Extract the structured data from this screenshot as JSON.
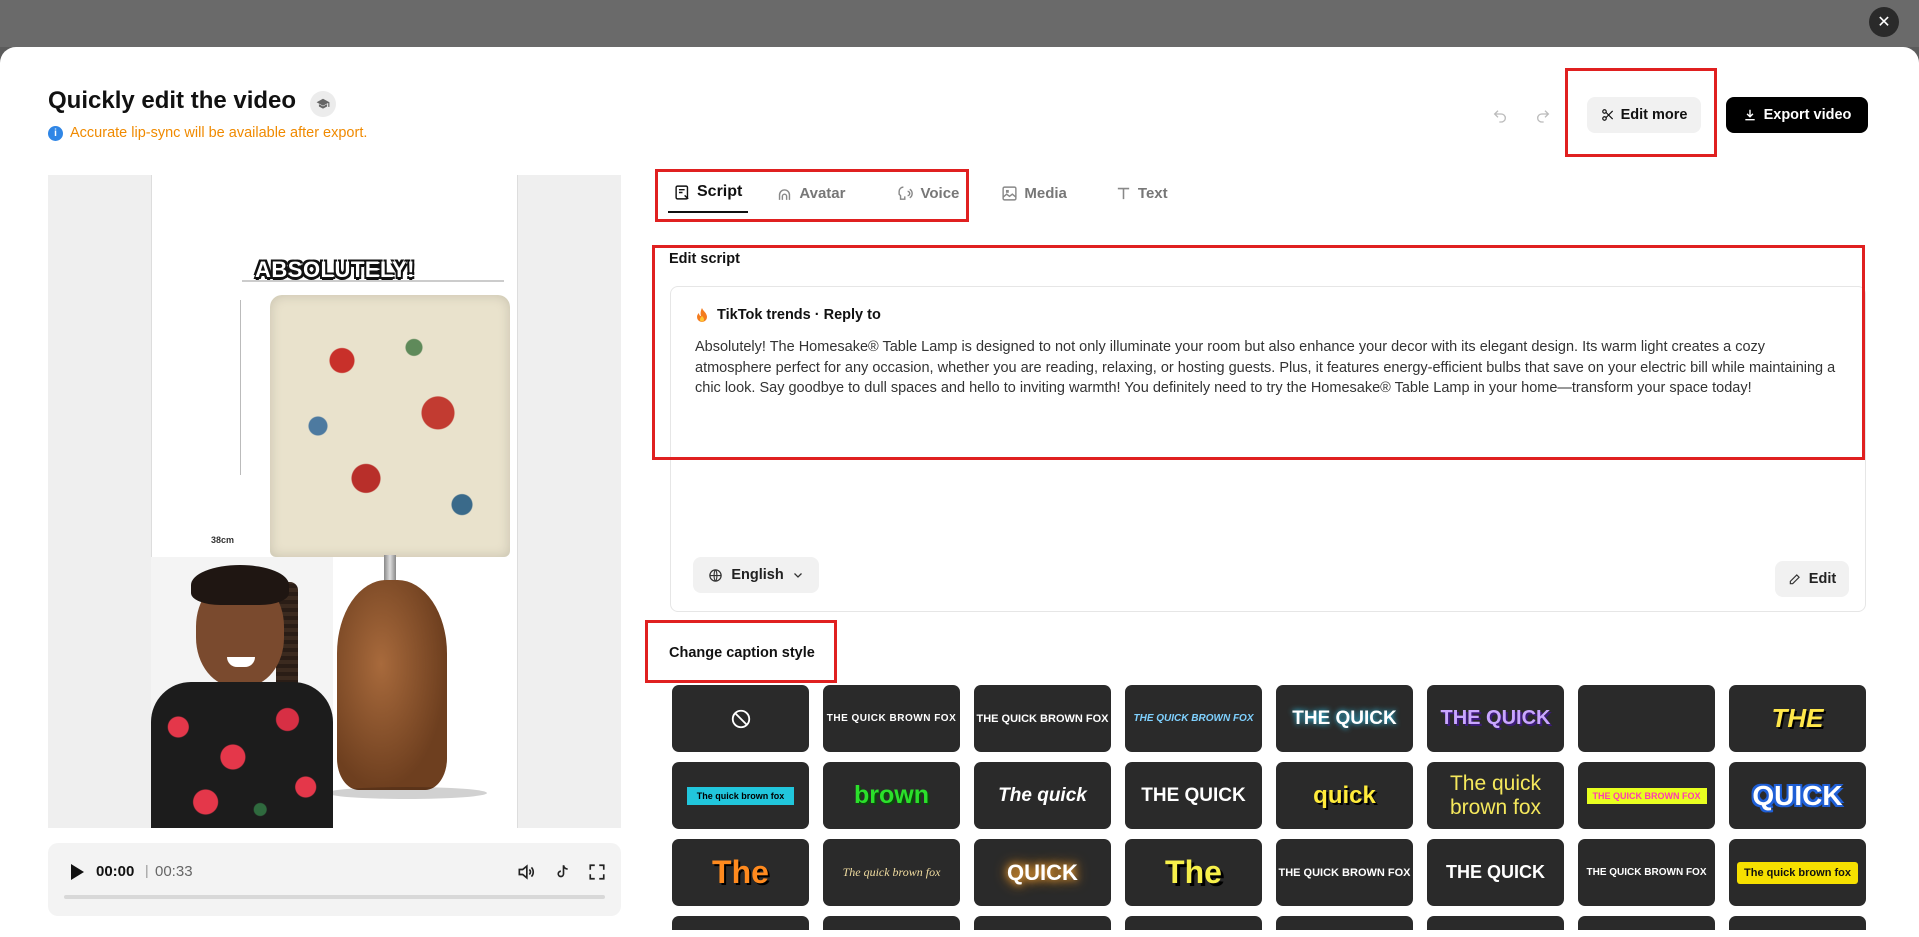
{
  "modal": {
    "title": "Quickly edit the video",
    "notice": "Accurate lip-sync will be available after export.",
    "edit_more_label": "Edit more",
    "export_label": "Export video"
  },
  "preview": {
    "caption_word": "ABSOLUTELY!",
    "dimension_label": "38cm",
    "time_current": "00:00",
    "time_total": "00:33",
    "progress_fraction": 0
  },
  "tabs": [
    {
      "label": "Script",
      "icon": "script-icon",
      "active": true
    },
    {
      "label": "Avatar",
      "icon": "avatar-icon",
      "active": false
    },
    {
      "label": "Voice",
      "icon": "voice-icon",
      "active": false
    },
    {
      "label": "Media",
      "icon": "media-icon",
      "active": false
    },
    {
      "label": "Text",
      "icon": "text-icon",
      "active": false
    }
  ],
  "script": {
    "section_title": "Edit script",
    "trend_label": "TikTok trends · Reply to",
    "text": "Absolutely! The Homesake® Table Lamp is designed to not only illuminate your room but also enhance your decor with its elegant design. Its warm light creates a cozy atmosphere perfect for any occasion, whether you are reading, relaxing, or hosting guests. Plus, it features energy-efficient bulbs that save on your electric bill while maintaining a chic look. Say goodbye to dull spaces and hello to inviting warmth! You definitely need to try the Homesake® Table Lamp in your home—transform your space today!",
    "language": "English",
    "edit_label": "Edit"
  },
  "caption_styles": {
    "section_title": "Change caption style",
    "items": [
      {
        "label": "",
        "kind": "none"
      },
      {
        "label": "THE QUICK BROWN FOX",
        "kind": "s1"
      },
      {
        "label": "THE QUICK BROWN FOX",
        "kind": "s2"
      },
      {
        "label": "THE QUICK BROWN FOX",
        "kind": "s3"
      },
      {
        "label": "THE QUICK",
        "kind": "s4"
      },
      {
        "label": "THE QUICK",
        "kind": "s5"
      },
      {
        "label": "",
        "kind": "blank"
      },
      {
        "label": "THE",
        "kind": "s7"
      },
      {
        "label": "The quick brown fox",
        "kind": "s8"
      },
      {
        "label": "brown",
        "kind": "s9"
      },
      {
        "label": "The quick",
        "kind": "s10"
      },
      {
        "label": "THE QUICK",
        "kind": "s11"
      },
      {
        "label": "quick",
        "kind": "s12"
      },
      {
        "label": "The quick brown fox",
        "kind": "s13"
      },
      {
        "label": "THE QUICK BROWN FOX",
        "kind": "s14"
      },
      {
        "label": "QUICK",
        "kind": "s15"
      },
      {
        "label": "The",
        "kind": "s16"
      },
      {
        "label": "The quick brown fox",
        "kind": "s17"
      },
      {
        "label": "QUICK",
        "kind": "s18"
      },
      {
        "label": "The",
        "kind": "s19"
      },
      {
        "label": "THE QUICK BROWN FOX",
        "kind": "s20"
      },
      {
        "label": "THE QUICK",
        "kind": "s21"
      },
      {
        "label": "THE QUICK BROWN FOX",
        "kind": "s22"
      },
      {
        "label": "The quick brown fox",
        "kind": "s23"
      },
      {
        "label": "",
        "kind": "blank"
      },
      {
        "label": "",
        "kind": "blank"
      },
      {
        "label": "",
        "kind": "blank"
      },
      {
        "label": "",
        "kind": "blank"
      },
      {
        "label": "",
        "kind": "blank"
      },
      {
        "label": "",
        "kind": "blank"
      },
      {
        "label": "",
        "kind": "blank"
      },
      {
        "label": "",
        "kind": "blank"
      }
    ]
  },
  "colors": {
    "notice": "#f08a00",
    "info": "#2f86e6",
    "highlight_border": "#e02020",
    "export_bg": "#000000"
  }
}
